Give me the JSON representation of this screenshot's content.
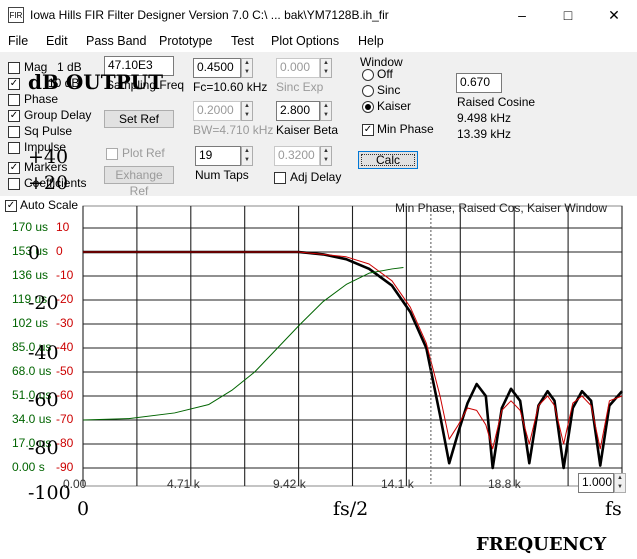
{
  "window": {
    "title": "Iowa Hills FIR Filter Designer  Version 7.0   C:\\ ... bak\\YM7128B.ih_fir",
    "app_icon": "FIR"
  },
  "menu": [
    "File",
    "Edit",
    "Pass Band",
    "Prototype",
    "Test",
    "Plot Options",
    "Help"
  ],
  "checks": {
    "mag": "Mag",
    "mag_db": "1 dB",
    "mag_10db": "10 dB",
    "phase": "Phase",
    "group_delay": "Group Delay",
    "sq_pulse": "Sq Pulse",
    "impulse": "Impulse",
    "markers": "Markers",
    "coefficients": "Coefficients",
    "plot_ref": "Plot Ref",
    "auto_scale": "Auto Scale",
    "adj_delay": "Adj Delay",
    "min_phase": "Min Phase"
  },
  "fields": {
    "sampling_freq": "47.10E3",
    "sampling_freq_label": "Sampling Freq",
    "fc": "0.4500",
    "fc_label": "Fc=10.60 kHz",
    "sinc_exp": "0.000",
    "sinc_exp_label": "Sinc Exp",
    "bw": "0.2000",
    "bw_label": "BW=4.710 kHz",
    "kaiser_beta": "2.800",
    "kaiser_beta_label": "Kaiser Beta",
    "num_taps": "19",
    "num_taps_label": "Num Taps",
    "adj": "0.3200",
    "raised_cos": "0.670",
    "raised_cos_label": "Raised Cosine",
    "f1": "9.498 kHz",
    "f2": "13.39 kHz",
    "zoom": "1.000"
  },
  "buttons": {
    "set_ref": "Set Ref",
    "exchange_ref": "Exhange Ref",
    "calc": "Calc"
  },
  "window_group": {
    "label": "Window",
    "off": "Off",
    "sinc": "Sinc",
    "kaiser": "Kaiser"
  },
  "plot": {
    "caption": "Min Phase, Raised Cos, Kaiser Window",
    "gd_labels": [
      "170 us",
      "153 us",
      "136 us",
      "119 us",
      "102 us",
      "85.0 us",
      "68.0 us",
      "51.0 us",
      "34.0 us",
      "17.0 us",
      "0.00 s"
    ],
    "db_labels": [
      "10",
      "0",
      "-10",
      "-20",
      "-30",
      "-40",
      "-50",
      "-60",
      "-70",
      "-80",
      "-90"
    ],
    "x_labels": [
      "0.00",
      "4.71 k",
      "9.42 k",
      "14.1 k",
      "18.8 k"
    ],
    "overlay": {
      "title": "dB OUTPUT",
      "y_ticks": [
        "+40",
        "+20",
        "0",
        "-20",
        "-40",
        "-60",
        "-80",
        "-100"
      ],
      "x_ticks": [
        "0",
        "fs/2",
        "fs"
      ],
      "xlabel": "FREQUENCY"
    }
  },
  "chart_data": {
    "type": "line",
    "title": "Min Phase, Raised Cos, Kaiser Window",
    "xlabel": "FREQUENCY",
    "ylabel": "dB OUTPUT",
    "xlim": [
      0,
      23550
    ],
    "ylim": [
      -90,
      10
    ],
    "series": [
      {
        "color": "#000000",
        "x": [
          0,
          5000,
          9420,
          10500,
          11500,
          12500,
          13500,
          14300,
          15000,
          15600,
          16000,
          16400,
          16800,
          17200,
          17600,
          17900,
          18300,
          18700,
          19100,
          19500,
          19900,
          20300,
          20600,
          21000,
          21400,
          21800,
          22200,
          22600,
          23000,
          23550
        ],
        "y": [
          0,
          0,
          0,
          -1,
          -3,
          -7,
          -14,
          -25,
          -40,
          -68,
          -88,
          -75,
          -63,
          -55,
          -60,
          -90,
          -65,
          -57,
          -62,
          -88,
          -64,
          -58,
          -62,
          -90,
          -65,
          -58,
          -62,
          -89,
          -64,
          -58
        ]
      },
      {
        "color": "#cc0000",
        "x": [
          0,
          5000,
          9420,
          10500,
          11500,
          12500,
          13500,
          14300,
          15000,
          15600,
          16000,
          16400,
          16800,
          17200,
          17600,
          17900,
          18300,
          18700,
          19100,
          19500,
          19900,
          20300,
          20600,
          21000,
          21400,
          21800,
          22200,
          22600,
          23000,
          23550
        ],
        "y": [
          0,
          0,
          0,
          -1,
          -2,
          -5,
          -12,
          -23,
          -38,
          -60,
          -78,
          -72,
          -65,
          -66,
          -72,
          -82,
          -66,
          -62,
          -66,
          -80,
          -64,
          -60,
          -64,
          -80,
          -63,
          -60,
          -64,
          -82,
          -62,
          -60
        ]
      },
      {
        "color": "#006400",
        "axis": "group-delay",
        "x": [
          0,
          2000,
          4000,
          5500,
          6500,
          7500,
          8500,
          9500,
          10500,
          11500,
          12500,
          13500,
          14000
        ],
        "y": [
          34,
          35,
          39,
          45,
          55,
          68,
          85,
          102,
          118,
          130,
          138,
          141,
          142
        ]
      }
    ]
  }
}
